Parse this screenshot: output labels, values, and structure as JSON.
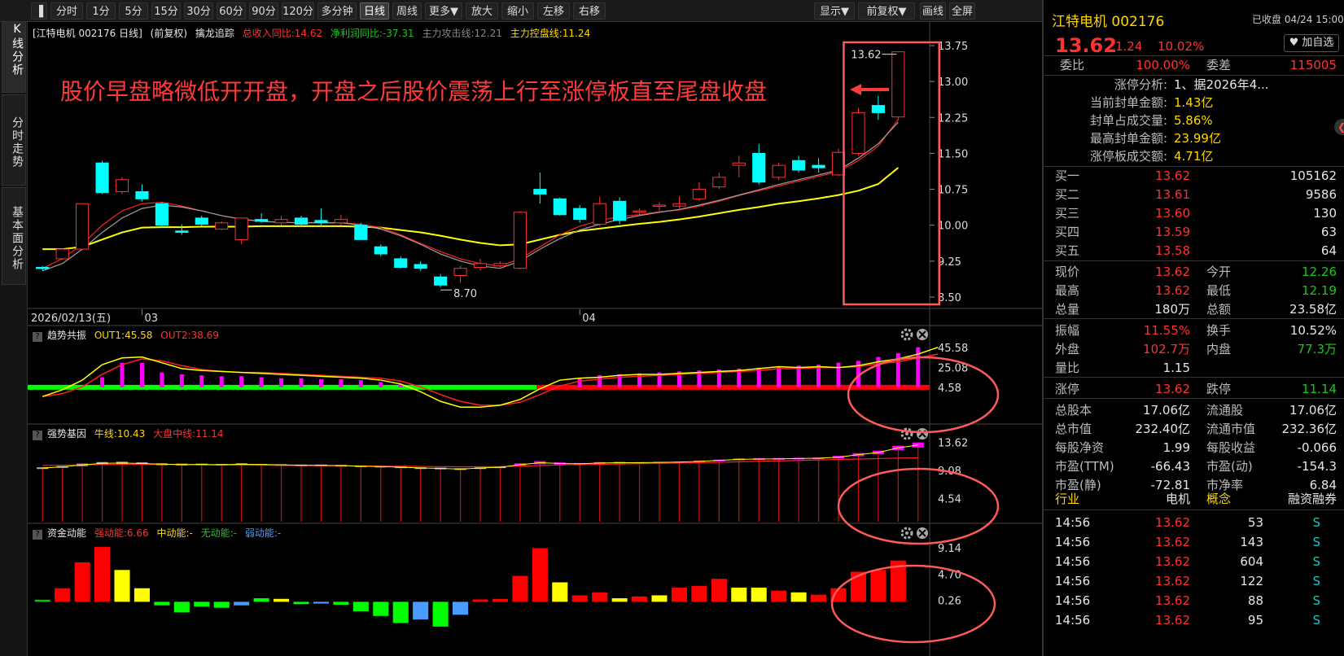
{
  "toolbar": {
    "items": [
      "分时",
      "1分",
      "5分",
      "15分",
      "30分",
      "60分",
      "90分",
      "120分",
      "多分钟",
      "日线",
      "周线",
      "更多▼",
      "放大",
      "缩小",
      "左移",
      "右移"
    ],
    "active": "日线",
    "right_items": [
      "显示▼",
      "前复权▼",
      "画线",
      "全屏"
    ]
  },
  "left_tabs": [
    {
      "label": "K线分析"
    },
    {
      "label": "分时走势"
    },
    {
      "label": "基本面分析"
    }
  ],
  "main_header": {
    "title": "[江特电机 002176 日线]",
    "adj": "(前复权)",
    "indicator": "擒龙追踪",
    "rev": "总收入同比:14.62",
    "profit": "净利润同比:-37.31",
    "atk": "主力攻击线:12.21",
    "ctrl": "主力控盘线:11.24"
  },
  "annotation": "股价早盘略微低开开盘，开盘之后股价震荡上行至涨停板直至尾盘收盘",
  "date_axis": {
    "left": "2026/02/13(五)",
    "m1": "03",
    "m2": "04"
  },
  "sub1_header": {
    "name": "趋势共振",
    "o1": "OUT1:45.58",
    "o2": "OUT2:38.69"
  },
  "sub2_header": {
    "name": "强势基因",
    "a": "牛线:10.43",
    "b": "大盘中线:11.14"
  },
  "sub3_header": {
    "name": "资金动能",
    "a": "强动能:6.66",
    "b": "中动能:-",
    "c": "无动能:-",
    "d": "弱动能:-"
  },
  "colors": {
    "up": "#ff3232",
    "down": "#00ffff",
    "ma_yellow": "#ffff00",
    "ma_red": "#ff2020",
    "ma_gray": "#a0a0a0",
    "accent": "#ffd700",
    "circle": "#ff5a5a"
  },
  "chart_data": [
    {
      "type": "candlestick",
      "title": "江特电机 002176 日线",
      "ylim": [
        8.5,
        13.75
      ],
      "yticks": [
        "13.75",
        "13.00",
        "12.25",
        "11.50",
        "10.75",
        "10.00",
        "9.25",
        "8.50"
      ],
      "high_label": "13.62",
      "low_label": "8.70",
      "ohlc": [
        [
          9.12,
          9.15,
          9.05,
          9.1
        ],
        [
          9.3,
          9.52,
          9.28,
          9.5
        ],
        [
          9.5,
          10.45,
          9.48,
          10.45
        ],
        [
          11.3,
          11.35,
          10.65,
          10.68
        ],
        [
          10.7,
          11.0,
          10.65,
          10.95
        ],
        [
          10.7,
          10.85,
          10.5,
          10.55
        ],
        [
          10.45,
          10.48,
          9.95,
          10.0
        ],
        [
          9.88,
          10.02,
          9.8,
          9.85
        ],
        [
          10.15,
          10.2,
          9.98,
          10.02
        ],
        [
          9.92,
          10.08,
          9.9,
          10.05
        ],
        [
          9.7,
          10.16,
          9.6,
          10.15
        ],
        [
          10.12,
          10.25,
          10.05,
          10.08
        ],
        [
          10.05,
          10.2,
          10.0,
          10.12
        ],
        [
          10.15,
          10.2,
          9.98,
          10.02
        ],
        [
          10.1,
          10.35,
          10.0,
          10.05
        ],
        [
          10.05,
          10.22,
          10.0,
          10.12
        ],
        [
          10.0,
          10.05,
          9.7,
          9.7
        ],
        [
          9.55,
          9.6,
          9.35,
          9.4
        ],
        [
          9.3,
          9.35,
          9.1,
          9.12
        ],
        [
          9.18,
          9.25,
          9.05,
          9.1
        ],
        [
          8.92,
          8.98,
          8.7,
          8.75
        ],
        [
          8.95,
          9.15,
          8.8,
          9.1
        ],
        [
          9.12,
          9.3,
          9.05,
          9.2
        ],
        [
          9.15,
          9.25,
          9.12,
          9.2
        ],
        [
          9.1,
          10.3,
          9.08,
          10.27
        ],
        [
          10.75,
          11.1,
          10.45,
          10.65
        ],
        [
          10.55,
          10.58,
          10.2,
          10.22
        ],
        [
          10.35,
          10.42,
          10.05,
          10.12
        ],
        [
          10.02,
          10.6,
          9.98,
          10.45
        ],
        [
          10.5,
          10.58,
          10.02,
          10.1
        ],
        [
          10.28,
          10.35,
          10.2,
          10.3
        ],
        [
          10.4,
          10.48,
          10.3,
          10.42
        ],
        [
          10.4,
          10.6,
          10.35,
          10.45
        ],
        [
          10.55,
          10.9,
          10.5,
          10.75
        ],
        [
          10.8,
          11.1,
          10.75,
          11.0
        ],
        [
          11.25,
          11.45,
          11.0,
          11.3
        ],
        [
          11.5,
          11.7,
          10.85,
          10.9
        ],
        [
          11.0,
          11.3,
          10.95,
          11.25
        ],
        [
          11.35,
          11.45,
          11.1,
          11.15
        ],
        [
          11.25,
          11.4,
          11.1,
          11.2
        ],
        [
          11.05,
          11.6,
          11.02,
          11.52
        ],
        [
          11.5,
          12.45,
          11.45,
          12.35
        ],
        [
          12.5,
          12.7,
          12.2,
          12.35
        ],
        [
          12.26,
          13.62,
          12.19,
          13.62
        ]
      ],
      "ma_yellow": [
        9.5,
        9.5,
        9.55,
        9.7,
        9.85,
        9.95,
        9.96,
        9.96,
        9.97,
        9.97,
        9.97,
        9.98,
        9.98,
        9.98,
        9.98,
        9.98,
        9.97,
        9.95,
        9.9,
        9.85,
        9.78,
        9.7,
        9.63,
        9.58,
        9.6,
        9.7,
        9.8,
        9.88,
        9.93,
        9.98,
        10.03,
        10.07,
        10.12,
        10.18,
        10.25,
        10.32,
        10.38,
        10.45,
        10.5,
        10.56,
        10.63,
        10.72,
        10.86,
        11.2
      ],
      "ma_red": [
        9.1,
        9.3,
        9.6,
        10.0,
        10.3,
        10.45,
        10.48,
        10.4,
        10.3,
        10.2,
        10.12,
        10.08,
        10.06,
        10.05,
        10.06,
        10.05,
        10.02,
        9.95,
        9.8,
        9.62,
        9.45,
        9.3,
        9.2,
        9.15,
        9.3,
        9.55,
        9.8,
        9.98,
        10.1,
        10.18,
        10.22,
        10.28,
        10.32,
        10.4,
        10.5,
        10.62,
        10.72,
        10.82,
        10.92,
        11.02,
        11.12,
        11.35,
        11.65,
        12.21
      ],
      "ma_gray": [
        9.05,
        9.2,
        9.5,
        9.85,
        10.15,
        10.35,
        10.42,
        10.38,
        10.3,
        10.2,
        10.13,
        10.08,
        10.06,
        10.05,
        10.05,
        10.05,
        10.0,
        9.92,
        9.78,
        9.6,
        9.4,
        9.25,
        9.15,
        9.1,
        9.25,
        9.5,
        9.72,
        9.9,
        10.02,
        10.12,
        10.2,
        10.27,
        10.33,
        10.42,
        10.52,
        10.63,
        10.74,
        10.85,
        10.95,
        11.05,
        11.15,
        11.4,
        11.7,
        12.15
      ]
    },
    {
      "type": "bar",
      "title": "趋势共振",
      "yticks": [
        "45.58",
        "25.08",
        "4.58"
      ],
      "ylim": [
        -20,
        50
      ],
      "out1": [
        -5,
        2,
        12,
        28,
        35,
        36,
        30,
        24,
        22,
        21,
        20,
        19,
        18,
        17,
        16,
        15,
        14,
        12,
        8,
        0,
        -10,
        -16,
        -16,
        -14,
        -8,
        3,
        12,
        14,
        15,
        17,
        18,
        18,
        19,
        20,
        21,
        22,
        24,
        26,
        25,
        26,
        25,
        27,
        31,
        34,
        39,
        46
      ],
      "out2": [
        -5,
        -2,
        5,
        18,
        28,
        34,
        32,
        27,
        23,
        21,
        20,
        20,
        19,
        18,
        17,
        16,
        15,
        14,
        11,
        5,
        -3,
        -10,
        -14,
        -14,
        -11,
        -3,
        6,
        11,
        13,
        15,
        16,
        17,
        18,
        19,
        20,
        21,
        22,
        24,
        24,
        25,
        25,
        26,
        29,
        31,
        35,
        39
      ],
      "bars": [
        0,
        0,
        0,
        15,
        30,
        30,
        20,
        18,
        17,
        16,
        16,
        15,
        14,
        14,
        13,
        13,
        12,
        10,
        8,
        0,
        0,
        0,
        0,
        0,
        0,
        0,
        0,
        14,
        17,
        18,
        19,
        20,
        21,
        22,
        23,
        24,
        25,
        26,
        27,
        28,
        30,
        32,
        36,
        40,
        46
      ]
    },
    {
      "type": "bar",
      "title": "强势基因",
      "yticks": [
        "13.62",
        "9.08",
        "4.54"
      ],
      "ylim": [
        1.6,
        14.5
      ],
      "blocks": [
        [
          9.4,
          9.6
        ],
        [
          9.55,
          9.8
        ],
        [
          9.8,
          10.2
        ],
        [
          10.05,
          10.45
        ],
        [
          10.1,
          10.5
        ],
        [
          10.05,
          10.4
        ],
        [
          9.95,
          10.25
        ],
        [
          9.9,
          10.2
        ],
        [
          9.95,
          10.2
        ],
        [
          9.9,
          10.15
        ],
        [
          9.95,
          10.25
        ],
        [
          9.95,
          10.15
        ],
        [
          9.9,
          10.1
        ],
        [
          9.85,
          10.05
        ],
        [
          9.8,
          10.05
        ],
        [
          9.75,
          10.0
        ],
        [
          9.7,
          9.9
        ],
        [
          9.6,
          9.85
        ],
        [
          9.5,
          9.75
        ],
        [
          9.4,
          9.6
        ],
        [
          9.3,
          9.55
        ],
        [
          9.2,
          9.45
        ],
        [
          9.4,
          9.6
        ],
        [
          9.5,
          9.75
        ],
        [
          9.8,
          10.25
        ],
        [
          10.1,
          10.6
        ],
        [
          10.05,
          10.4
        ],
        [
          10.05,
          10.3
        ],
        [
          10.15,
          10.45
        ],
        [
          10.2,
          10.5
        ],
        [
          10.25,
          10.45
        ],
        [
          10.3,
          10.5
        ],
        [
          10.35,
          10.55
        ],
        [
          10.45,
          10.7
        ],
        [
          10.6,
          10.85
        ],
        [
          10.75,
          11.05
        ],
        [
          10.8,
          11.1
        ],
        [
          10.85,
          11.1
        ],
        [
          10.9,
          11.15
        ],
        [
          10.95,
          11.2
        ],
        [
          11.05,
          11.45
        ],
        [
          11.4,
          11.9
        ],
        [
          11.7,
          12.3
        ],
        [
          12.4,
          13.1
        ],
        [
          12.8,
          13.62
        ]
      ],
      "line": [
        9.9,
        9.95,
        10.0,
        10.05,
        10.1,
        10.1,
        10.08,
        10.05,
        10.0,
        9.98,
        9.95,
        9.95,
        9.92,
        9.9,
        9.88,
        9.85,
        9.82,
        9.8,
        9.78,
        9.75,
        9.72,
        9.7,
        9.7,
        9.72,
        9.8,
        9.9,
        10.0,
        10.05,
        10.1,
        10.15,
        10.2,
        10.25,
        10.3,
        10.35,
        10.42,
        10.5,
        10.58,
        10.65,
        10.72,
        10.8,
        10.88,
        10.95,
        11.02,
        11.1,
        11.14
      ]
    },
    {
      "type": "bar",
      "title": "资金动能",
      "yticks": [
        "9.14",
        "4.70",
        "0.26"
      ],
      "ylim": [
        -4.5,
        10
      ],
      "values": [
        0.35,
        2.3,
        6.7,
        9.3,
        5.4,
        2.3,
        -0.6,
        -1.8,
        -0.8,
        -1.0,
        -0.6,
        0.6,
        0.5,
        -0.4,
        -0.3,
        -0.5,
        -1.6,
        -2.4,
        -3.6,
        -3.0,
        -4.2,
        -2.2,
        0.4,
        0.5,
        4.4,
        9.1,
        3.3,
        1.1,
        1.6,
        0.6,
        0.9,
        1.1,
        2.4,
        2.7,
        3.9,
        2.4,
        2.4,
        1.9,
        1.6,
        1.2,
        2.3,
        5.1,
        5.4,
        7.0
      ],
      "colors": [
        "#00c800",
        "#ff0000",
        "#ff0000",
        "#ff0000",
        "#ffff00",
        "#ffff00",
        "#00ff00",
        "#00ff00",
        "#00ff00",
        "#00ff00",
        "#4a9cff",
        "#00ff00",
        "#ffff00",
        "#00ff00",
        "#4a9cff",
        "#00ff00",
        "#00ff00",
        "#00ff00",
        "#00ff00",
        "#4a9cff",
        "#00ff00",
        "#4a9cff",
        "#ff0000",
        "#ff0000",
        "#ff0000",
        "#ff0000",
        "#ffff00",
        "#ff0000",
        "#ff0000",
        "#ffff00",
        "#ff0000",
        "#ffff00",
        "#ff0000",
        "#ff0000",
        "#ff0000",
        "#ffff00",
        "#ffff00",
        "#ff0000",
        "#ffff00",
        "#ff0000",
        "#ff0000",
        "#ff0000",
        "#ff0000",
        "#ff0000"
      ]
    }
  ],
  "right_panel": {
    "name": "江特电机 002176",
    "status": "已收盘 04/24 15:00",
    "price": "13.62",
    "change": "1.24",
    "pct": "10.02%",
    "add_label": "♥ 加自选",
    "wb_label": "委比",
    "wb_value": "100.00%",
    "wc_label": "委差",
    "wc_value": "115005",
    "limit_info": [
      {
        "k": "涨停分析:",
        "v": "1、据2026年4..."
      },
      {
        "k": "当前封单金额:",
        "v": "1.43亿"
      },
      {
        "k": "封单占成交量:",
        "v": "5.86%"
      },
      {
        "k": "最高封单金额:",
        "v": "23.99亿"
      },
      {
        "k": "涨停板成交额:",
        "v": "4.71亿"
      }
    ],
    "bids": [
      {
        "l": "买一",
        "p": "13.62",
        "v": "105162"
      },
      {
        "l": "买二",
        "p": "13.61",
        "v": "9586"
      },
      {
        "l": "买三",
        "p": "13.60",
        "v": "130"
      },
      {
        "l": "买四",
        "p": "13.59",
        "v": "63"
      },
      {
        "l": "买五",
        "p": "13.58",
        "v": "64"
      }
    ],
    "stats": [
      {
        "k1": "现价",
        "v1": "13.62",
        "k2": "今开",
        "v2": "12.26",
        "c1": "red",
        "c2": "grn"
      },
      {
        "k1": "最高",
        "v1": "13.62",
        "k2": "最低",
        "v2": "12.19",
        "c1": "red",
        "c2": "grn"
      },
      {
        "k1": "总量",
        "v1": "180万",
        "k2": "总额",
        "v2": "23.58亿",
        "c1": "wht",
        "c2": "wht"
      }
    ],
    "stats2": [
      {
        "k1": "振幅",
        "v1": "11.55%",
        "k2": "换手",
        "v2": "10.52%",
        "c1": "red",
        "c2": "wht"
      },
      {
        "k1": "外盘",
        "v1": "102.7万",
        "k2": "内盘",
        "v2": "77.3万",
        "c1": "red",
        "c2": "grn"
      },
      {
        "k1": "量比",
        "v1": "1.15",
        "k2": "",
        "v2": "",
        "c1": "wht",
        "c2": "wht"
      }
    ],
    "stats3": [
      {
        "k1": "涨停",
        "v1": "13.62",
        "k2": "跌停",
        "v2": "11.14",
        "c1": "red",
        "c2": "grn"
      }
    ],
    "fund": [
      {
        "k1": "总股本",
        "v1": "17.06亿",
        "k2": "流通股",
        "v2": "17.06亿"
      },
      {
        "k1": "总市值",
        "v1": "232.40亿",
        "k2": "流通市值",
        "v2": "232.36亿"
      },
      {
        "k1": "每股净资",
        "v1": "1.99",
        "k2": "每股收益",
        "v2": "-0.066"
      },
      {
        "k1": "市盈(TTM)",
        "v1": "-66.43",
        "k2": "市盈(动)",
        "v2": "-154.3"
      },
      {
        "k1": "市盈(静)",
        "v1": "-72.81",
        "k2": "市净率",
        "v2": "6.84"
      }
    ],
    "industry": {
      "k1": "行业",
      "v1": "电机",
      "k2": "概念",
      "v2": "融资融券"
    },
    "ticks": [
      {
        "t": "14:56",
        "p": "13.62",
        "v": "53",
        "s": "S"
      },
      {
        "t": "14:56",
        "p": "13.62",
        "v": "143",
        "s": "S"
      },
      {
        "t": "14:56",
        "p": "13.62",
        "v": "604",
        "s": "S"
      },
      {
        "t": "14:56",
        "p": "13.62",
        "v": "122",
        "s": "S"
      },
      {
        "t": "14:56",
        "p": "13.62",
        "v": "88",
        "s": "S"
      },
      {
        "t": "14:56",
        "p": "13.62",
        "v": "95",
        "s": "S"
      }
    ]
  }
}
